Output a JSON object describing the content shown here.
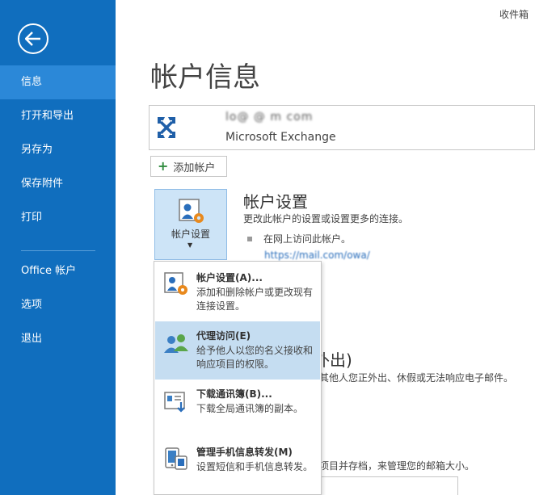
{
  "window": {
    "caption": "收件箱"
  },
  "sidebar": {
    "items": [
      {
        "label": "信息",
        "active": true
      },
      {
        "label": "打开和导出",
        "active": false
      },
      {
        "label": "另存为",
        "active": false
      },
      {
        "label": "保存附件",
        "active": false
      },
      {
        "label": "打印",
        "active": false
      },
      {
        "label": "Office 帐户",
        "active": false
      },
      {
        "label": "选项",
        "active": false
      },
      {
        "label": "退出",
        "active": false
      }
    ]
  },
  "main": {
    "title": "帐户信息",
    "account": {
      "email": "lo@ @ m com",
      "type": "Microsoft Exchange"
    },
    "add_account_label": "添加帐户",
    "settings_tile_label": "帐户设置",
    "section": {
      "heading": "帐户设置",
      "description": "更改此帐户的设置或设置更多的连接。",
      "bullet": "在网上访问此帐户。",
      "link": "https://mail.com/owa/"
    },
    "background": {
      "heading_fragment": "外出)",
      "text_fragment": "其他人您正外出、休假或无法响应电子邮件。",
      "text_fragment2": "项目并存档，来管理您的邮箱大小。"
    }
  },
  "menu": {
    "items": [
      {
        "title": "帐户设置(A)...",
        "desc": "添加和删除帐户或更改现有连接设置。",
        "icon": "account-settings-icon"
      },
      {
        "title": "代理访问(E)",
        "desc": "给予他人以您的名义接收和响应项目的权限。",
        "icon": "delegate-access-icon"
      },
      {
        "title": "下载通讯簿(B)...",
        "desc": "下载全局通讯簿的副本。",
        "icon": "download-address-book-icon"
      },
      {
        "title": "管理手机信息转发(M)",
        "desc": "设置短信和手机信息转发。",
        "icon": "mobile-forwarding-icon"
      }
    ]
  },
  "colors": {
    "sidebar": "#106ebe",
    "sidebar_active": "#2b88d8",
    "menu_hover": "#c5ddf1"
  }
}
